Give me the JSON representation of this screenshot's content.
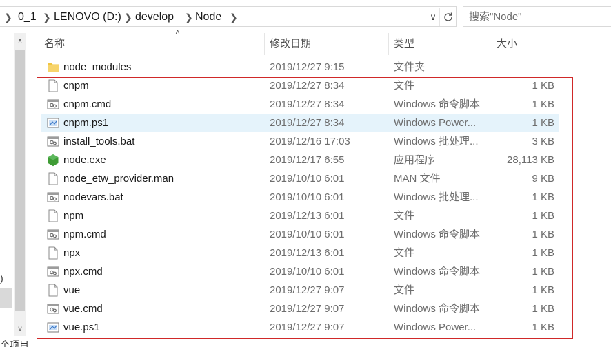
{
  "address_bar": {
    "breadcrumbs": [
      "0_1",
      "LENOVO (D:)",
      "develop",
      "Node"
    ]
  },
  "search": {
    "placeholder": "搜索\"Node\""
  },
  "columns": {
    "name": "名称",
    "date": "修改日期",
    "type": "类型",
    "size": "大小"
  },
  "nav_fragment": ")",
  "status_fragment": "个项目",
  "files": [
    {
      "name": "node_modules",
      "date": "2019/12/27 9:15",
      "type": "文件夹",
      "size": "",
      "icon": "folder-icon"
    },
    {
      "name": "cnpm",
      "date": "2019/12/27 8:34",
      "type": "文件",
      "size": "1 KB",
      "icon": "file-icon"
    },
    {
      "name": "cnpm.cmd",
      "date": "2019/12/27 8:34",
      "type": "Windows 命令脚本",
      "size": "1 KB",
      "icon": "cmd-file-icon"
    },
    {
      "name": "cnpm.ps1",
      "date": "2019/12/27 8:34",
      "type": "Windows Power...",
      "size": "1 KB",
      "icon": "powershell-file-icon"
    },
    {
      "name": "install_tools.bat",
      "date": "2019/12/16 17:03",
      "type": "Windows 批处理...",
      "size": "3 KB",
      "icon": "cmd-file-icon"
    },
    {
      "name": "node.exe",
      "date": "2019/12/17 6:55",
      "type": "应用程序",
      "size": "28,113 KB",
      "icon": "node-exe-icon"
    },
    {
      "name": "node_etw_provider.man",
      "date": "2019/10/10 6:01",
      "type": "MAN 文件",
      "size": "9 KB",
      "icon": "file-icon"
    },
    {
      "name": "nodevars.bat",
      "date": "2019/10/10 6:01",
      "type": "Windows 批处理...",
      "size": "1 KB",
      "icon": "cmd-file-icon"
    },
    {
      "name": "npm",
      "date": "2019/12/13 6:01",
      "type": "文件",
      "size": "1 KB",
      "icon": "file-icon"
    },
    {
      "name": "npm.cmd",
      "date": "2019/10/10 6:01",
      "type": "Windows 命令脚本",
      "size": "1 KB",
      "icon": "cmd-file-icon"
    },
    {
      "name": "npx",
      "date": "2019/12/13 6:01",
      "type": "文件",
      "size": "1 KB",
      "icon": "file-icon"
    },
    {
      "name": "npx.cmd",
      "date": "2019/10/10 6:01",
      "type": "Windows 命令脚本",
      "size": "1 KB",
      "icon": "cmd-file-icon"
    },
    {
      "name": "vue",
      "date": "2019/12/27 9:07",
      "type": "文件",
      "size": "1 KB",
      "icon": "file-icon"
    },
    {
      "name": "vue.cmd",
      "date": "2019/12/27 9:07",
      "type": "Windows 命令脚本",
      "size": "1 KB",
      "icon": "cmd-file-icon"
    },
    {
      "name": "vue.ps1",
      "date": "2019/12/27 9:07",
      "type": "Windows Power...",
      "size": "1 KB",
      "icon": "powershell-file-icon"
    }
  ],
  "selected_file": "cnpm.ps1",
  "colors": {
    "highlight_border": "#d02929",
    "selection_bg": "#e5f3fb",
    "folder": "#f0c541",
    "node_green": "#3f9c35"
  }
}
